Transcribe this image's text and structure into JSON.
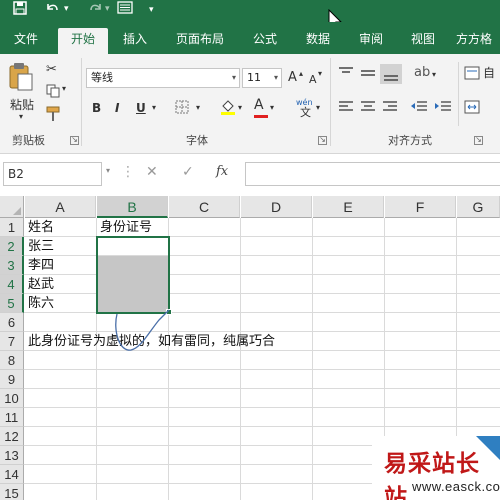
{
  "tabs": [
    "文件",
    "开始",
    "插入",
    "页面布局",
    "公式",
    "数据",
    "审阅",
    "视图",
    "方方格"
  ],
  "active_tab": "开始",
  "ribbon": {
    "clipboard": {
      "paste": "粘贴",
      "label": "剪贴板"
    },
    "font": {
      "name": "等线",
      "size": "11",
      "grow": "A",
      "shrink": "A",
      "bold": "B",
      "italic": "I",
      "underline": "U",
      "font_color": "A",
      "wen": "wén",
      "label": "字体"
    },
    "alignment": {
      "label": "对齐方式",
      "auto_wrap": "自"
    }
  },
  "formula_bar": {
    "name_box": "B2",
    "cancel": "✕",
    "enter": "✓",
    "fx": "fx",
    "value": ""
  },
  "columns": [
    "A",
    "B",
    "C",
    "D",
    "E",
    "F",
    "G"
  ],
  "rows": [
    "1",
    "2",
    "3",
    "4",
    "5",
    "6",
    "7",
    "8",
    "9",
    "10",
    "11",
    "12",
    "13",
    "14",
    "15"
  ],
  "selected_cell": "B2",
  "cells": {
    "a1": "姓名",
    "b1": "身份证号",
    "a2": "张三",
    "a3": "李四",
    "a4": "赵武",
    "a5": "陈六",
    "a7": "此身份证号为虚拟的，如有雷同，纯属巧合"
  },
  "watermark": {
    "main": "易采站长站",
    "url": "www.easck.com"
  },
  "colors": {
    "accent": "#217346",
    "selection_fill": "#c6c6c6",
    "watermark": "#c01818"
  }
}
